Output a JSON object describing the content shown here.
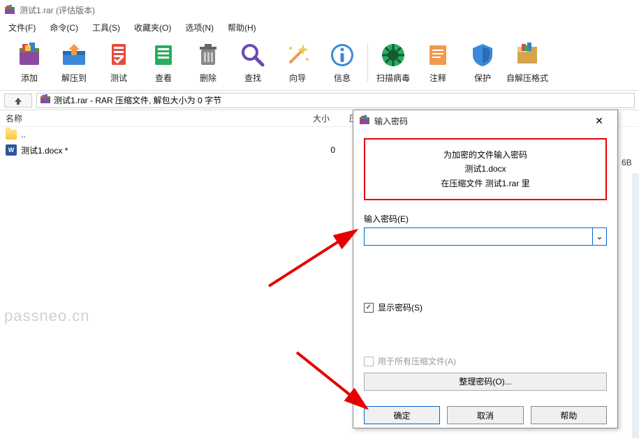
{
  "titlebar": {
    "text": "测试1.rar (评估版本)"
  },
  "menu": {
    "file": "文件(F)",
    "command": "命令(C)",
    "tools": "工具(S)",
    "fav": "收藏夹(O)",
    "options": "选项(N)",
    "help": "帮助(H)"
  },
  "toolbar": {
    "add": "添加",
    "extract": "解压到",
    "test": "测试",
    "view": "查看",
    "delete": "删除",
    "find": "查找",
    "wizard": "向导",
    "info": "信息",
    "scan": "扫描病毒",
    "comment": "注释",
    "protect": "保护",
    "sfx": "自解压格式"
  },
  "path": {
    "text": "测试1.rar - RAR 压缩文件, 解包大小为 0 字节"
  },
  "columns": {
    "name": "名称",
    "size": "大小",
    "compressed": "压缩"
  },
  "rows": {
    "up": "..",
    "file1_name": "测试1.docx *",
    "file1_size": "0"
  },
  "dialog": {
    "title": "输入密码",
    "msg_line1": "为加密的文件输入密码",
    "msg_line2": "测试1.docx",
    "msg_line3": "在压缩文件 测试1.rar 里",
    "field_label": "输入密码(E)",
    "show_pw": "显示密码(S)",
    "all_archives": "用于所有压缩文件(A)",
    "manage": "整理密码(O)...",
    "ok": "确定",
    "cancel": "取消",
    "help": "帮助"
  },
  "watermark": "passneo.cn",
  "right_hint": "6B"
}
